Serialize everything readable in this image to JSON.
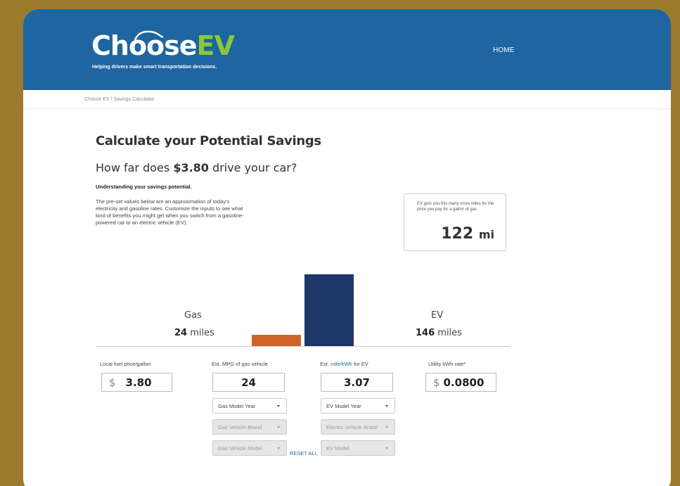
{
  "header": {
    "logo_choose": "Choose",
    "logo_ev": "EV",
    "logo_tagline": "Helping drivers make smart transportation decisions.",
    "nav_home": "HOME"
  },
  "breadcrumb": "Choose EV / Savings Calculator",
  "main": {
    "title": "Calculate your Potential Savings",
    "question_prefix": "How far does ",
    "question_amount": "$3.80",
    "question_suffix": " drive your car?",
    "subhead": "Understanding your savings potential.",
    "intro": "The pre-set values below are an approximation of today's electricity and gasoline rates. Customize the inputs to see what kind of benefits you might get when you switch from a gasoline-powered car to an electric vehicle (EV)."
  },
  "callout": {
    "text": "EV gets you this many more miles for the price you pay for a gallon of gas.",
    "value": "122",
    "unit": "mi"
  },
  "chart_data": {
    "type": "bar",
    "categories": [
      "Gas",
      "EV"
    ],
    "values": [
      24,
      146
    ],
    "colors": [
      "#cc6428",
      "#1c3768"
    ],
    "gas_label": "Gas",
    "gas_value": "24",
    "ev_label": "EV",
    "ev_value": "146",
    "unit": "miles"
  },
  "form": {
    "fuel_price_label": "Local fuel price/gallon",
    "fuel_price_currency": "$",
    "fuel_price_value": "3.80",
    "mpg_label": "Est. MPG of gas vehicle",
    "mpg_value": "24",
    "mile_kwh_prefix": "Est. ",
    "mile_kwh_link": "mile/kWh",
    "mile_kwh_suffix": " for EV",
    "mile_kwh_value": "3.07",
    "kwh_rate_label": "Utility kWh rate*",
    "kwh_rate_currency": "$",
    "kwh_rate_value": "0.0800",
    "gas_model_year": "Gas Model Year",
    "gas_vehicle_brand": "Gas Vehicle Brand",
    "gas_vehicle_model": "Gas Vehicle Model",
    "ev_model_year": "EV Model Year",
    "electric_vehicle_brand": "Electric Vehicle Brand",
    "ev_model": "EV Model"
  },
  "reset_label": "RESET ALL"
}
